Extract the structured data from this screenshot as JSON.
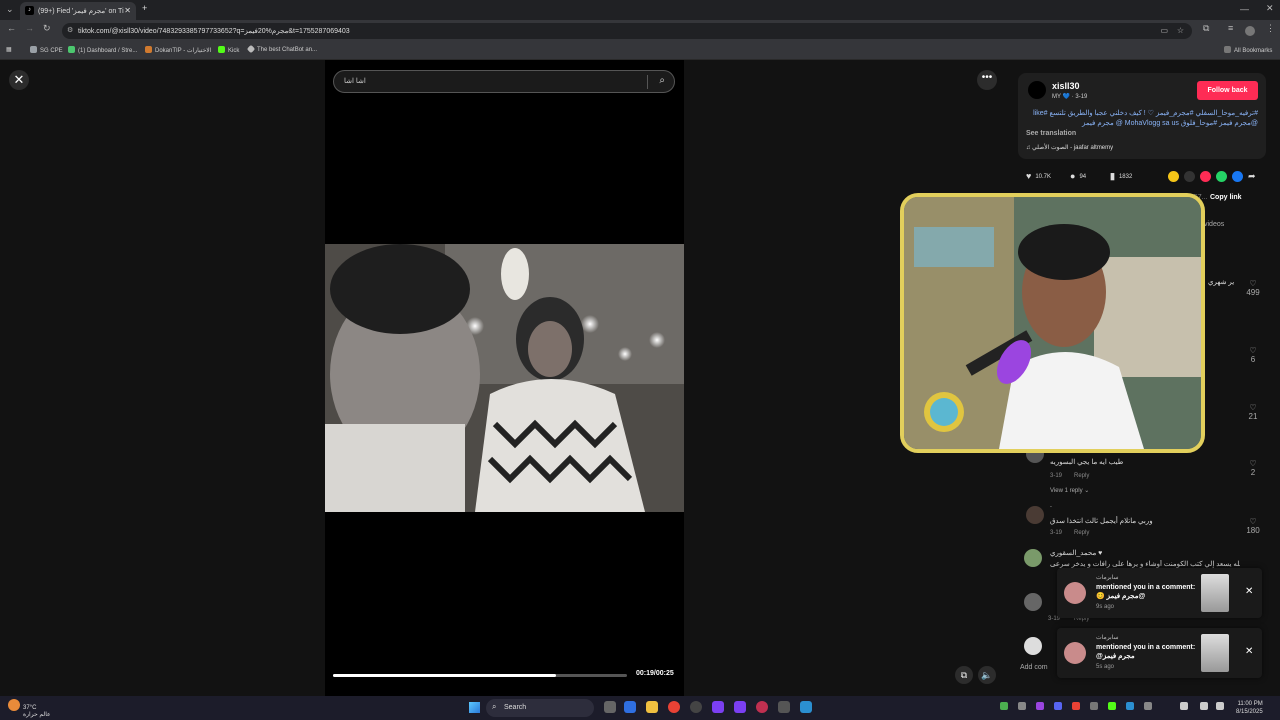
{
  "browser": {
    "tab_title": "(99+) Fied 'مجرم فيمز' on Ti",
    "tab_favicon": "tiktok-icon",
    "url": "tiktok.com/@xisll30/video/7483293385797733652?q=مجرم%20فيمز&t=1755287069403",
    "bookmarks": [
      {
        "label": "SG CPE",
        "color": "#9aa0a6"
      },
      {
        "label": "(1) Dashboard / Stre...",
        "color": "#4cc76f"
      },
      {
        "label": "DokanTIP - الاختيارات",
        "color": "#d07a2f"
      },
      {
        "label": "Kick",
        "color": "#53fc18"
      },
      {
        "label": "The best ChatBot an...",
        "color": "#bbbbbb"
      }
    ],
    "all_bookmarks": "All Bookmarks"
  },
  "search": {
    "query": "اشا اشا",
    "icon": "search-icon"
  },
  "player": {
    "current_time": "00:19",
    "duration": "00:25",
    "time_label": "00:19/00:25",
    "progress_fraction": 0.76
  },
  "post": {
    "username": "xisll30",
    "sub": "MY 💙 · 3-19",
    "follow_label": "Follow back",
    "description": "#ترفيه_موحا_السفلي #مجرم_فيمز ♡ ! كيف دخلني عجبا والطريق تلتسع #like @مجرم فيمز #موحا_فلوق MohaVlogg sa us @ مجرم فيمز",
    "see_translation": "See translation",
    "music": "♫  الصوت الأصلي - jaafar altmemy",
    "likes": "10.7K",
    "comments": "94",
    "saves": "1832",
    "copy_link": "Copy link",
    "url_peek": "857...",
    "videos_tab": "videos"
  },
  "comments": [
    {
      "text": "ير شهري",
      "likes": "499"
    },
    {
      "text": "",
      "likes": "6"
    },
    {
      "text": "",
      "likes": "21"
    },
    {
      "text": "طيب ايه ما يجي البسوريه",
      "date": "3-19",
      "reply": "Reply",
      "likes": "2",
      "view_replies": "View 1 reply ⌄"
    },
    {
      "text": "وربي ماتلام أيجمل ثالث انتخذا سدق",
      "date": "3-19",
      "reply": "Reply",
      "likes": "180",
      "name": "."
    },
    {
      "text": "الله يسعد إلي كتب الكومنت أوشاء و يرها على رافات و يدخر سرعى",
      "name": "محمد_السقوري ♥",
      "likes": ""
    },
    {
      "text": "",
      "date": "3-19",
      "reply": "Reply",
      "likes": "3"
    }
  ],
  "add_comment": "Add com",
  "notifications": [
    {
      "user": "سابرمات",
      "text": "mentioned you in a comment: 😊 مجرم فيمز@",
      "time": "9s ago"
    },
    {
      "user": "سابرمات",
      "text": "mentioned you in a comment: @مجرم فيمز",
      "time": "5s ago"
    }
  ],
  "taskbar": {
    "weather_temp": "37°C",
    "weather_text": "عالم حرارة",
    "search_label": "Search",
    "time": "11:00 PM",
    "date": "8/15/2025"
  }
}
